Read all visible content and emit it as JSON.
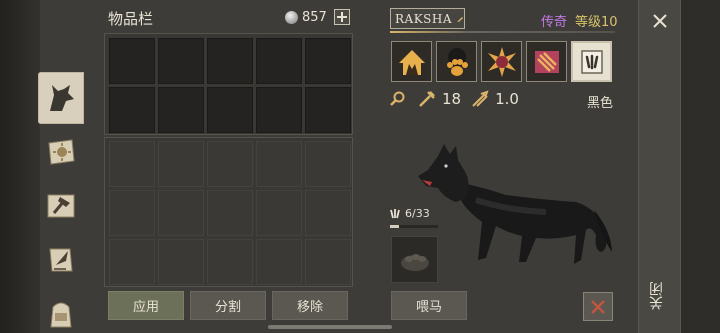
{
  "inventory": {
    "title": "物品栏",
    "currency_amount": "857",
    "buttons": {
      "apply": "应用",
      "split": "分割",
      "remove": "移除"
    }
  },
  "pet": {
    "name": "RAKSHA",
    "rarity": "传奇",
    "level": "等级10",
    "stats": {
      "attack": "18",
      "speed": "1.0"
    },
    "color_label": "黑色",
    "food": "6/33",
    "food_fraction": 0.18,
    "feed_button": "喂马"
  },
  "close_panel": {
    "label": "关闭"
  },
  "colors": {
    "rarity": "#c47ae6",
    "level": "#d8c46a",
    "accent_gold": "#d9b36a"
  },
  "icons": {
    "side_tabs": [
      "wolf-icon",
      "scroll-sun-icon",
      "map-hammer-icon",
      "scroll-quill-icon",
      "backpack-icon"
    ],
    "skills": [
      "house-skill-icon",
      "paw-skill-icon",
      "burst-skill-icon",
      "claw-scroll-skill-icon",
      "claw-card-skill-icon"
    ]
  }
}
